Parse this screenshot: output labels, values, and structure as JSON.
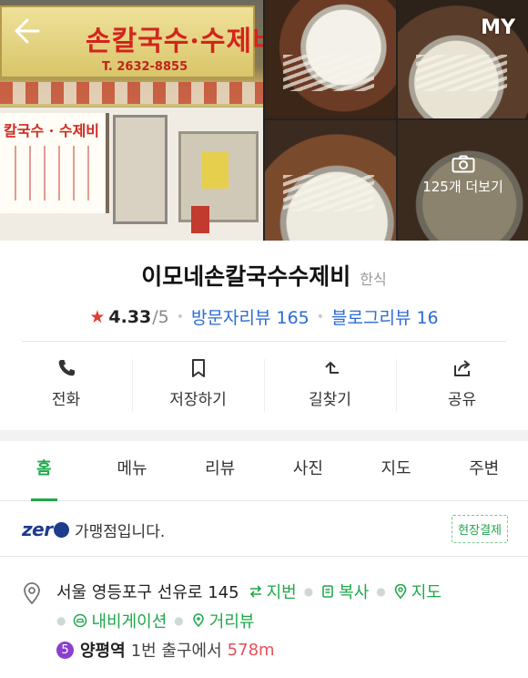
{
  "header": {
    "back_icon": "back-arrow-icon",
    "my_label": "MY",
    "more_photos": "125개 더보기",
    "camera_icon": "camera-icon",
    "storefront_sign": "손칼국수·수제비",
    "storefront_phone": "T. 2632-8855",
    "storefront_side_sign": "칼국수 · 수제비"
  },
  "place": {
    "name": "이모네손칼국수수제비",
    "category": "한식",
    "rating": "4.33",
    "rating_max": "/5",
    "visitor_reviews": "방문자리뷰 165",
    "blog_reviews": "블로그리뷰 16"
  },
  "actions": [
    {
      "label": "전화",
      "icon": "phone-icon"
    },
    {
      "label": "저장하기",
      "icon": "bookmark-icon"
    },
    {
      "label": "길찾기",
      "icon": "directions-icon"
    },
    {
      "label": "공유",
      "icon": "share-icon"
    }
  ],
  "tabs": [
    {
      "label": "홈",
      "active": true
    },
    {
      "label": "메뉴",
      "active": false
    },
    {
      "label": "리뷰",
      "active": false
    },
    {
      "label": "사진",
      "active": false
    },
    {
      "label": "지도",
      "active": false
    },
    {
      "label": "주변",
      "active": false
    }
  ],
  "zeropay": {
    "logo": "zer",
    "text": "가맹점입니다.",
    "badge": "현장결제"
  },
  "address": {
    "text": "서울 영등포구 선유로 145",
    "lot_link": "지번",
    "copy_link": "복사",
    "map_link": "지도",
    "navi_link": "내비게이션",
    "street_view_link": "거리뷰",
    "line_number": "5",
    "station": "양평역",
    "exit_text": "1번 출구에서",
    "distance": "578m"
  },
  "colors": {
    "accent_green": "#1fa84a",
    "link_blue": "#2b6bd6",
    "star_red": "#e23b2f",
    "line5_purple": "#8b3fd0",
    "distance_red": "#e6505a"
  }
}
